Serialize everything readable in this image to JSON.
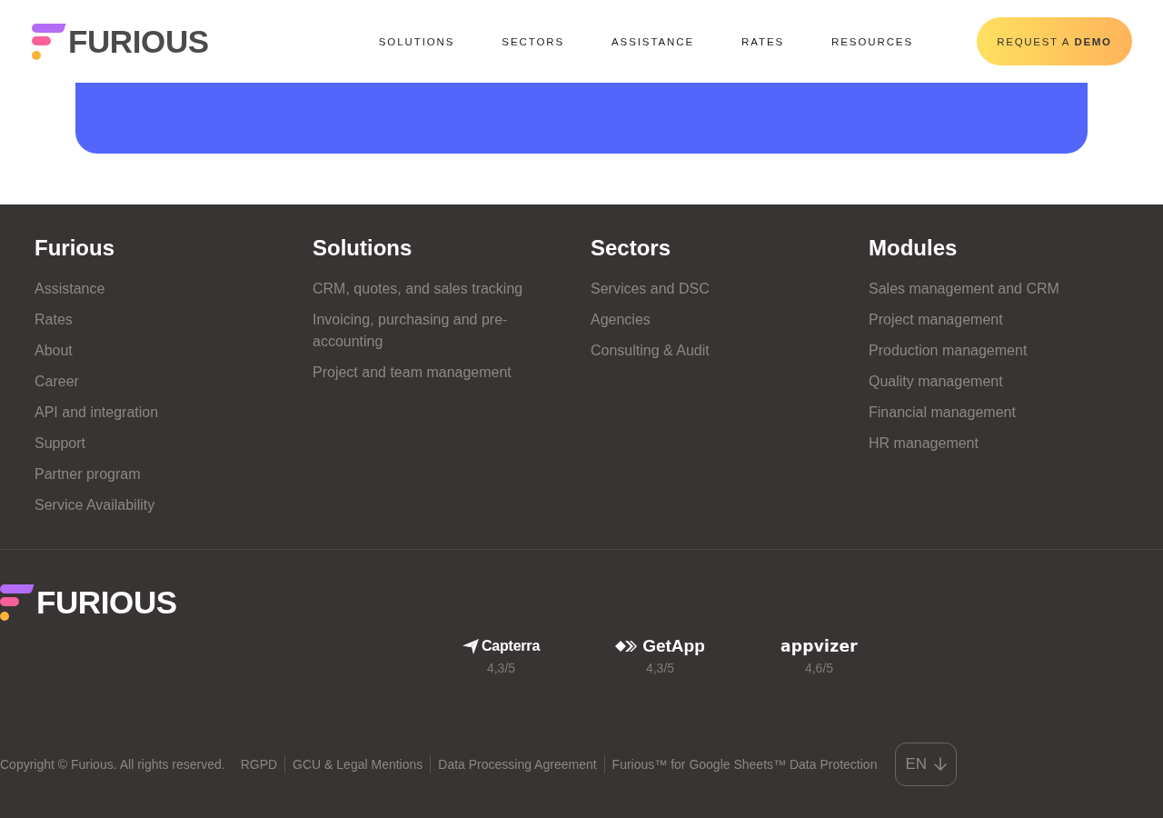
{
  "header": {
    "logo": {
      "wordmark": "FURIOUS"
    },
    "nav": [
      "SOLUTIONS",
      "SECTORS",
      "ASSISTANCE",
      "RATES",
      "RESOURCES"
    ],
    "cta_button": {
      "label": "REQUEST A **DEMO**"
    }
  },
  "footer": {
    "columns": [
      {
        "heading": "Furious",
        "links": [
          "Assistance",
          "Rates",
          "About",
          "Career",
          "API and integration",
          "Support",
          "Partner program",
          "Service Availability"
        ]
      },
      {
        "heading": "Solutions",
        "links": [
          "CRM, quotes, and sales tracking",
          "Invoicing, purchasing and pre-accounting",
          "Project and team management"
        ]
      },
      {
        "heading": "Sectors",
        "links": [
          "Services and DSC",
          "Agencies",
          "Consulting & Audit"
        ]
      },
      {
        "heading": "Modules",
        "links": [
          "Sales management and CRM",
          "Project management",
          "Production management",
          "Quality management",
          "Financial management",
          "HR management"
        ]
      }
    ],
    "logo": {
      "wordmark": "FURIOUS"
    },
    "review_sites": [
      {
        "kind": "capterra",
        "name": "Capterra",
        "rating": "4,3/5"
      },
      {
        "kind": "getapp",
        "name": "GetApp",
        "rating": "4,3/5"
      },
      {
        "kind": "appvizer",
        "name": "appvizer",
        "rating": "4,6/5"
      }
    ],
    "legal": {
      "copyright": "Copyright © Furious. All rights reserved.",
      "links": [
        "RGPD",
        "GCU & Legal Mentions",
        "Data Processing Agreement",
        "Furious™ for Google Sheets™ Data Protection"
      ]
    },
    "language": {
      "value": "EN"
    }
  }
}
